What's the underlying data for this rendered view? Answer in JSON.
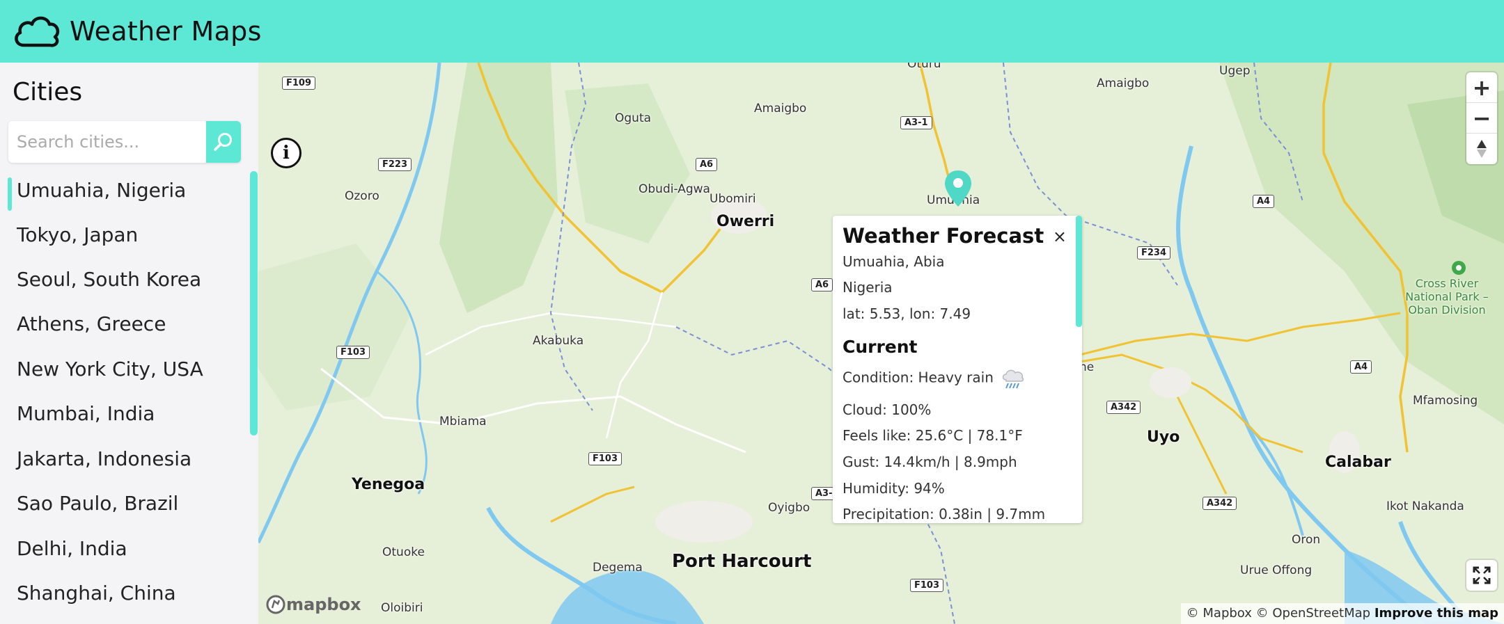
{
  "app": {
    "title": "Weather Maps",
    "icon": "cloud-icon"
  },
  "sidebar": {
    "title": "Cities",
    "search": {
      "placeholder": "Search cities...",
      "value": "",
      "button_icon": "search-icon"
    },
    "cities": [
      "Umuahia, Nigeria",
      "Tokyo, Japan",
      "Seoul, South Korea",
      "Athens, Greece",
      "New York City, USA",
      "Mumbai, India",
      "Jakarta, Indonesia",
      "Sao Paulo, Brazil",
      "Delhi, India",
      "Shanghai, China"
    ],
    "active_city": "Umuahia, Nigeria"
  },
  "map": {
    "labels": {
      "oguta": "Oguta",
      "amaigbo1": "Amaigbo",
      "amaigbo2": "Amaigbo",
      "ugep": "Ugep",
      "oturu": "Oturu",
      "obudi": "Obudi-Agwa",
      "ubomiri": "Ubomiri",
      "owerri": "Owerri",
      "ozoro": "Ozoro",
      "umuahia": "Umuahia",
      "akabuka": "Akabuka",
      "mbiama": "Mbiama",
      "yenegoa": "Yenegoa",
      "otuoke": "Otuoke",
      "degema": "Degema",
      "port_harcourt": "Port Harcourt",
      "oyigbo": "Oyigbo",
      "oloibiri": "Oloibiri",
      "uyo": "Uyo",
      "calabar": "Calabar",
      "mfamosing": "Mfamosing",
      "ikot": "Ikot Nakanda",
      "oron": "Oron",
      "urue": "Urue Offong",
      "park": "Cross River National Park – Oban Division",
      "ne": "ne"
    },
    "roads": {
      "f109": "F109",
      "f223": "F223",
      "f103a": "F103",
      "f103b": "F103",
      "f103c": "F103",
      "a6a": "A6",
      "a6b": "A6",
      "a31": "A3-1",
      "a4a": "A4",
      "a4b": "A4",
      "f234": "F234",
      "a342a": "A342",
      "a342b": "A342",
      "a3": "A3-"
    },
    "controls": {
      "zoom_in": "+",
      "zoom_out": "−"
    },
    "logo_text": "mapbox",
    "attribution": {
      "text": "© Mapbox © OpenStreetMap",
      "link": "Improve this map"
    }
  },
  "popup": {
    "title": "Weather Forecast",
    "close": "×",
    "location_line": "Umuahia,  Abia",
    "country": "Nigeria",
    "coords": "lat: 5.53,  lon: 7.49",
    "section": "Current",
    "condition": "Condition: Heavy rain",
    "condition_icon": "heavy-rain-icon",
    "cloud": "Cloud: 100%",
    "feels_like": "Feels like: 25.6°C | 78.1°F",
    "gust": "Gust: 14.4km/h | 8.9mph",
    "humidity": "Humidity: 94%",
    "precipitation": "Precipitation: 0.38in | 9.7mm"
  },
  "colors": {
    "accent": "#5de8d5",
    "land": "#e6efd8",
    "water": "#7fc8f0",
    "road": "#f1c232"
  }
}
